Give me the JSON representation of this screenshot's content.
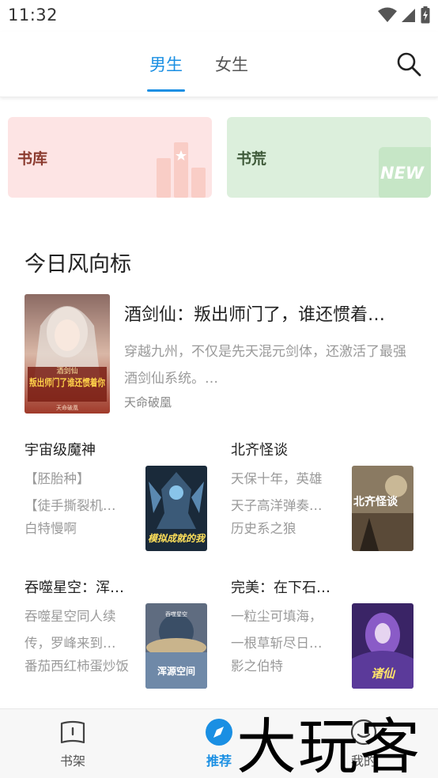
{
  "status_bar": {
    "time": "11:32",
    "icons": [
      "wifi-icon",
      "signal-icon",
      "battery-charging-icon"
    ]
  },
  "header": {
    "tabs": [
      {
        "label": "男生",
        "active": true
      },
      {
        "label": "女生",
        "active": false
      }
    ],
    "search_icon": "search-icon"
  },
  "quick_cards": [
    {
      "label": "书库"
    },
    {
      "label": "书荒",
      "badge": "NEW"
    }
  ],
  "section": {
    "title": "今日风向标"
  },
  "featured": {
    "title": "酒剑仙：叛出师门了，谁还惯着…",
    "description": "穿越九州，不仅是先天混元剑体，还激活了最强酒剑仙系统。…",
    "author": "天命破凰",
    "cover_text": "叛出师门了谁还惯着你",
    "cover_small": "酒剑仙",
    "cover_author": "天命破凰"
  },
  "grid_books": [
    {
      "title": "宇宙级魔神",
      "desc_lines": [
        "【胚胎种】",
        "【徒手撕裂机…"
      ],
      "author": "白特慢啊",
      "cover_text": "模拟成就的我"
    },
    {
      "title": "北齐怪谈",
      "desc_lines": [
        "天保十年，英雄",
        "天子高洋弹奏…"
      ],
      "author": "历史系之狼",
      "cover_text": "北齐怪谈"
    },
    {
      "title": "吞噬星空：浑…",
      "desc_lines": [
        "吞噬星空同人续",
        "传，罗峰来到…"
      ],
      "author": "番茄西红柿蛋炒饭",
      "cover_text": "浑源空间",
      "cover_small": "吞噬星空"
    },
    {
      "title": "完美：在下石…",
      "desc_lines": [
        "一粒尘可填海，",
        "一根草斩尽日…"
      ],
      "author": "影之伯特",
      "cover_text": "诸仙"
    }
  ],
  "bottom_nav": [
    {
      "label": "书架",
      "icon": "book-shelf-icon",
      "active": false
    },
    {
      "label": "推荐",
      "icon": "compass-icon",
      "active": true
    },
    {
      "label": "我的",
      "icon": "profile-icon",
      "active": false
    }
  ],
  "watermark": {
    "text": "大玩客"
  },
  "colors": {
    "accent": "#1a8fe3",
    "card_lib_bg": "#fde4e4",
    "card_short_bg": "#dcefdc",
    "muted_text": "#9a9a9a"
  }
}
